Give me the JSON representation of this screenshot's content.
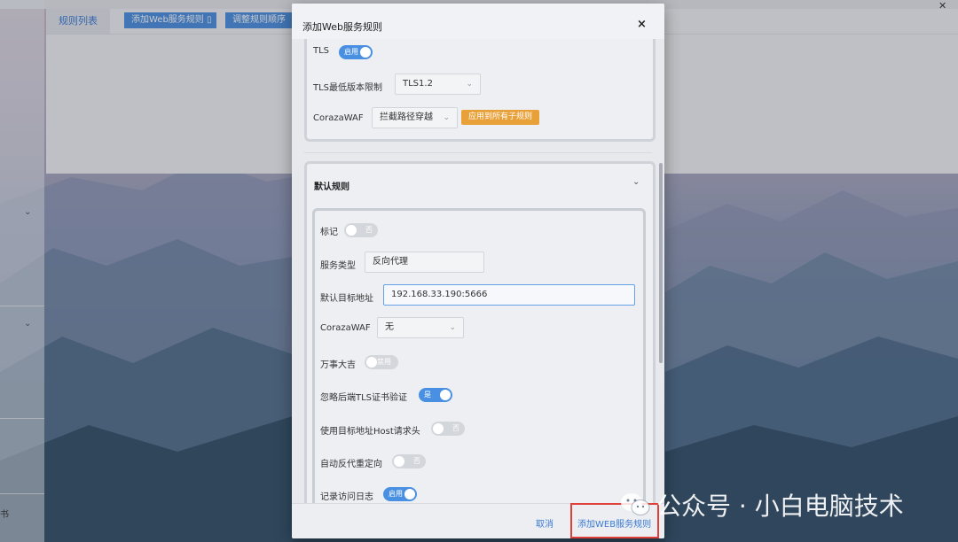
{
  "background_panel": {
    "tab_active": "规则列表",
    "add_web_rule_button": "添加Web服务规则",
    "adjust_order_button": "调整规则顺序"
  },
  "left_nav": {
    "partial_char": "书"
  },
  "modal": {
    "title": "添加Web服务规则",
    "close": "×",
    "tls": {
      "label": "TLS",
      "toggle": "启用"
    },
    "tls_min": {
      "label": "TLS最低版本限制",
      "value": "TLS1.2"
    },
    "coraza_top": {
      "label": "CorazaWAF",
      "value": "拦截路径穿越",
      "apply_button": "应用到所有子规则"
    },
    "default_rule": {
      "title": "默认规则",
      "mark": {
        "label": "标记",
        "toggle": "否"
      },
      "service_type": {
        "label": "服务类型",
        "value": "反向代理"
      },
      "default_target": {
        "label": "默认目标地址",
        "value": "192.168.33.190:5666"
      },
      "coraza": {
        "label": "CorazaWAF",
        "value": "无"
      },
      "wanshi": {
        "label": "万事大吉",
        "toggle": "禁用"
      },
      "ignore_tls": {
        "label": "忽略后端TLS证书验证",
        "toggle": "是"
      },
      "use_host": {
        "label": "使用目标地址Host请求头",
        "toggle": "否"
      },
      "auto_redirect": {
        "label": "自动反代重定向",
        "toggle": "否"
      },
      "access_log": {
        "label": "记录访问日志",
        "toggle": "启用"
      }
    },
    "footer": {
      "cancel": "取消",
      "submit": "添加WEB服务规则"
    }
  },
  "watermark": "公众号 · 小白电脑技术",
  "colors": {
    "primary": "#4a90e2",
    "warning": "#e8a038",
    "highlight": "#e0403a"
  }
}
